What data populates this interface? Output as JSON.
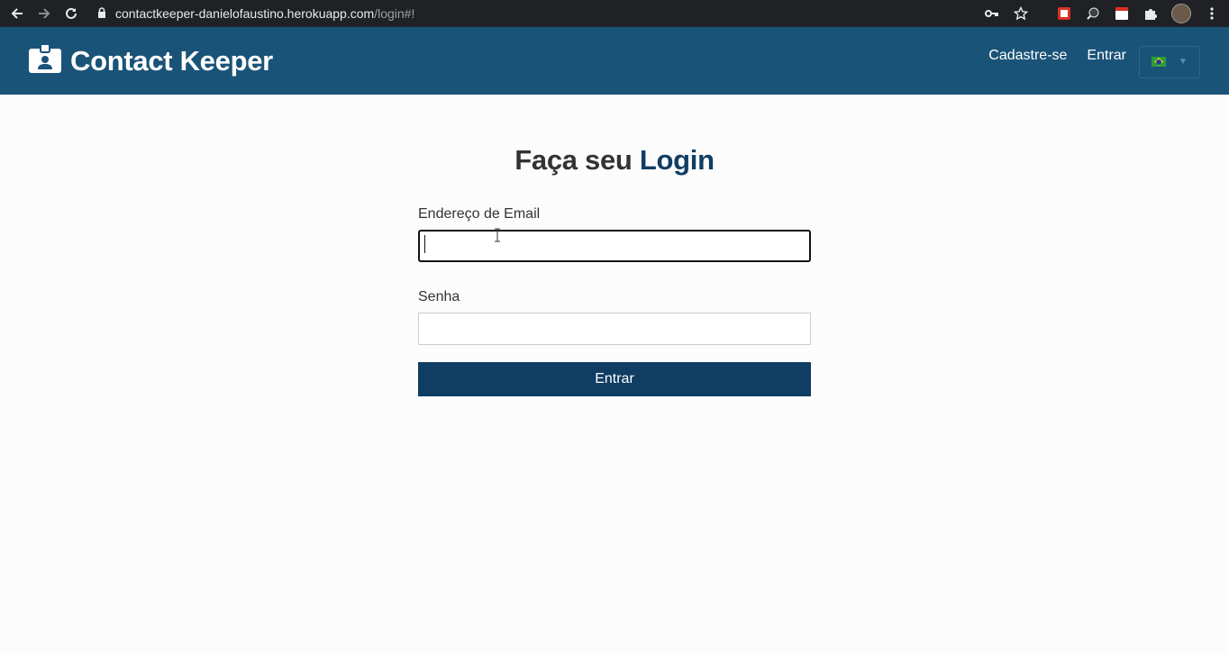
{
  "browser": {
    "url_host": "contactkeeper-danielofaustino.herokuapp.com",
    "url_path": "/login#!"
  },
  "navbar": {
    "brand": "Contact Keeper",
    "links": [
      "Cadastre-se",
      "Entrar"
    ],
    "language": "pt-BR",
    "brand_color": "#1a5378"
  },
  "login": {
    "heading_prefix": "Faça seu",
    "heading_accent": "Login",
    "email_label": "Endereço de Email",
    "email_value": "",
    "password_label": "Senha",
    "password_value": "",
    "submit_label": "Entrar",
    "accent_color": "#103d63"
  }
}
